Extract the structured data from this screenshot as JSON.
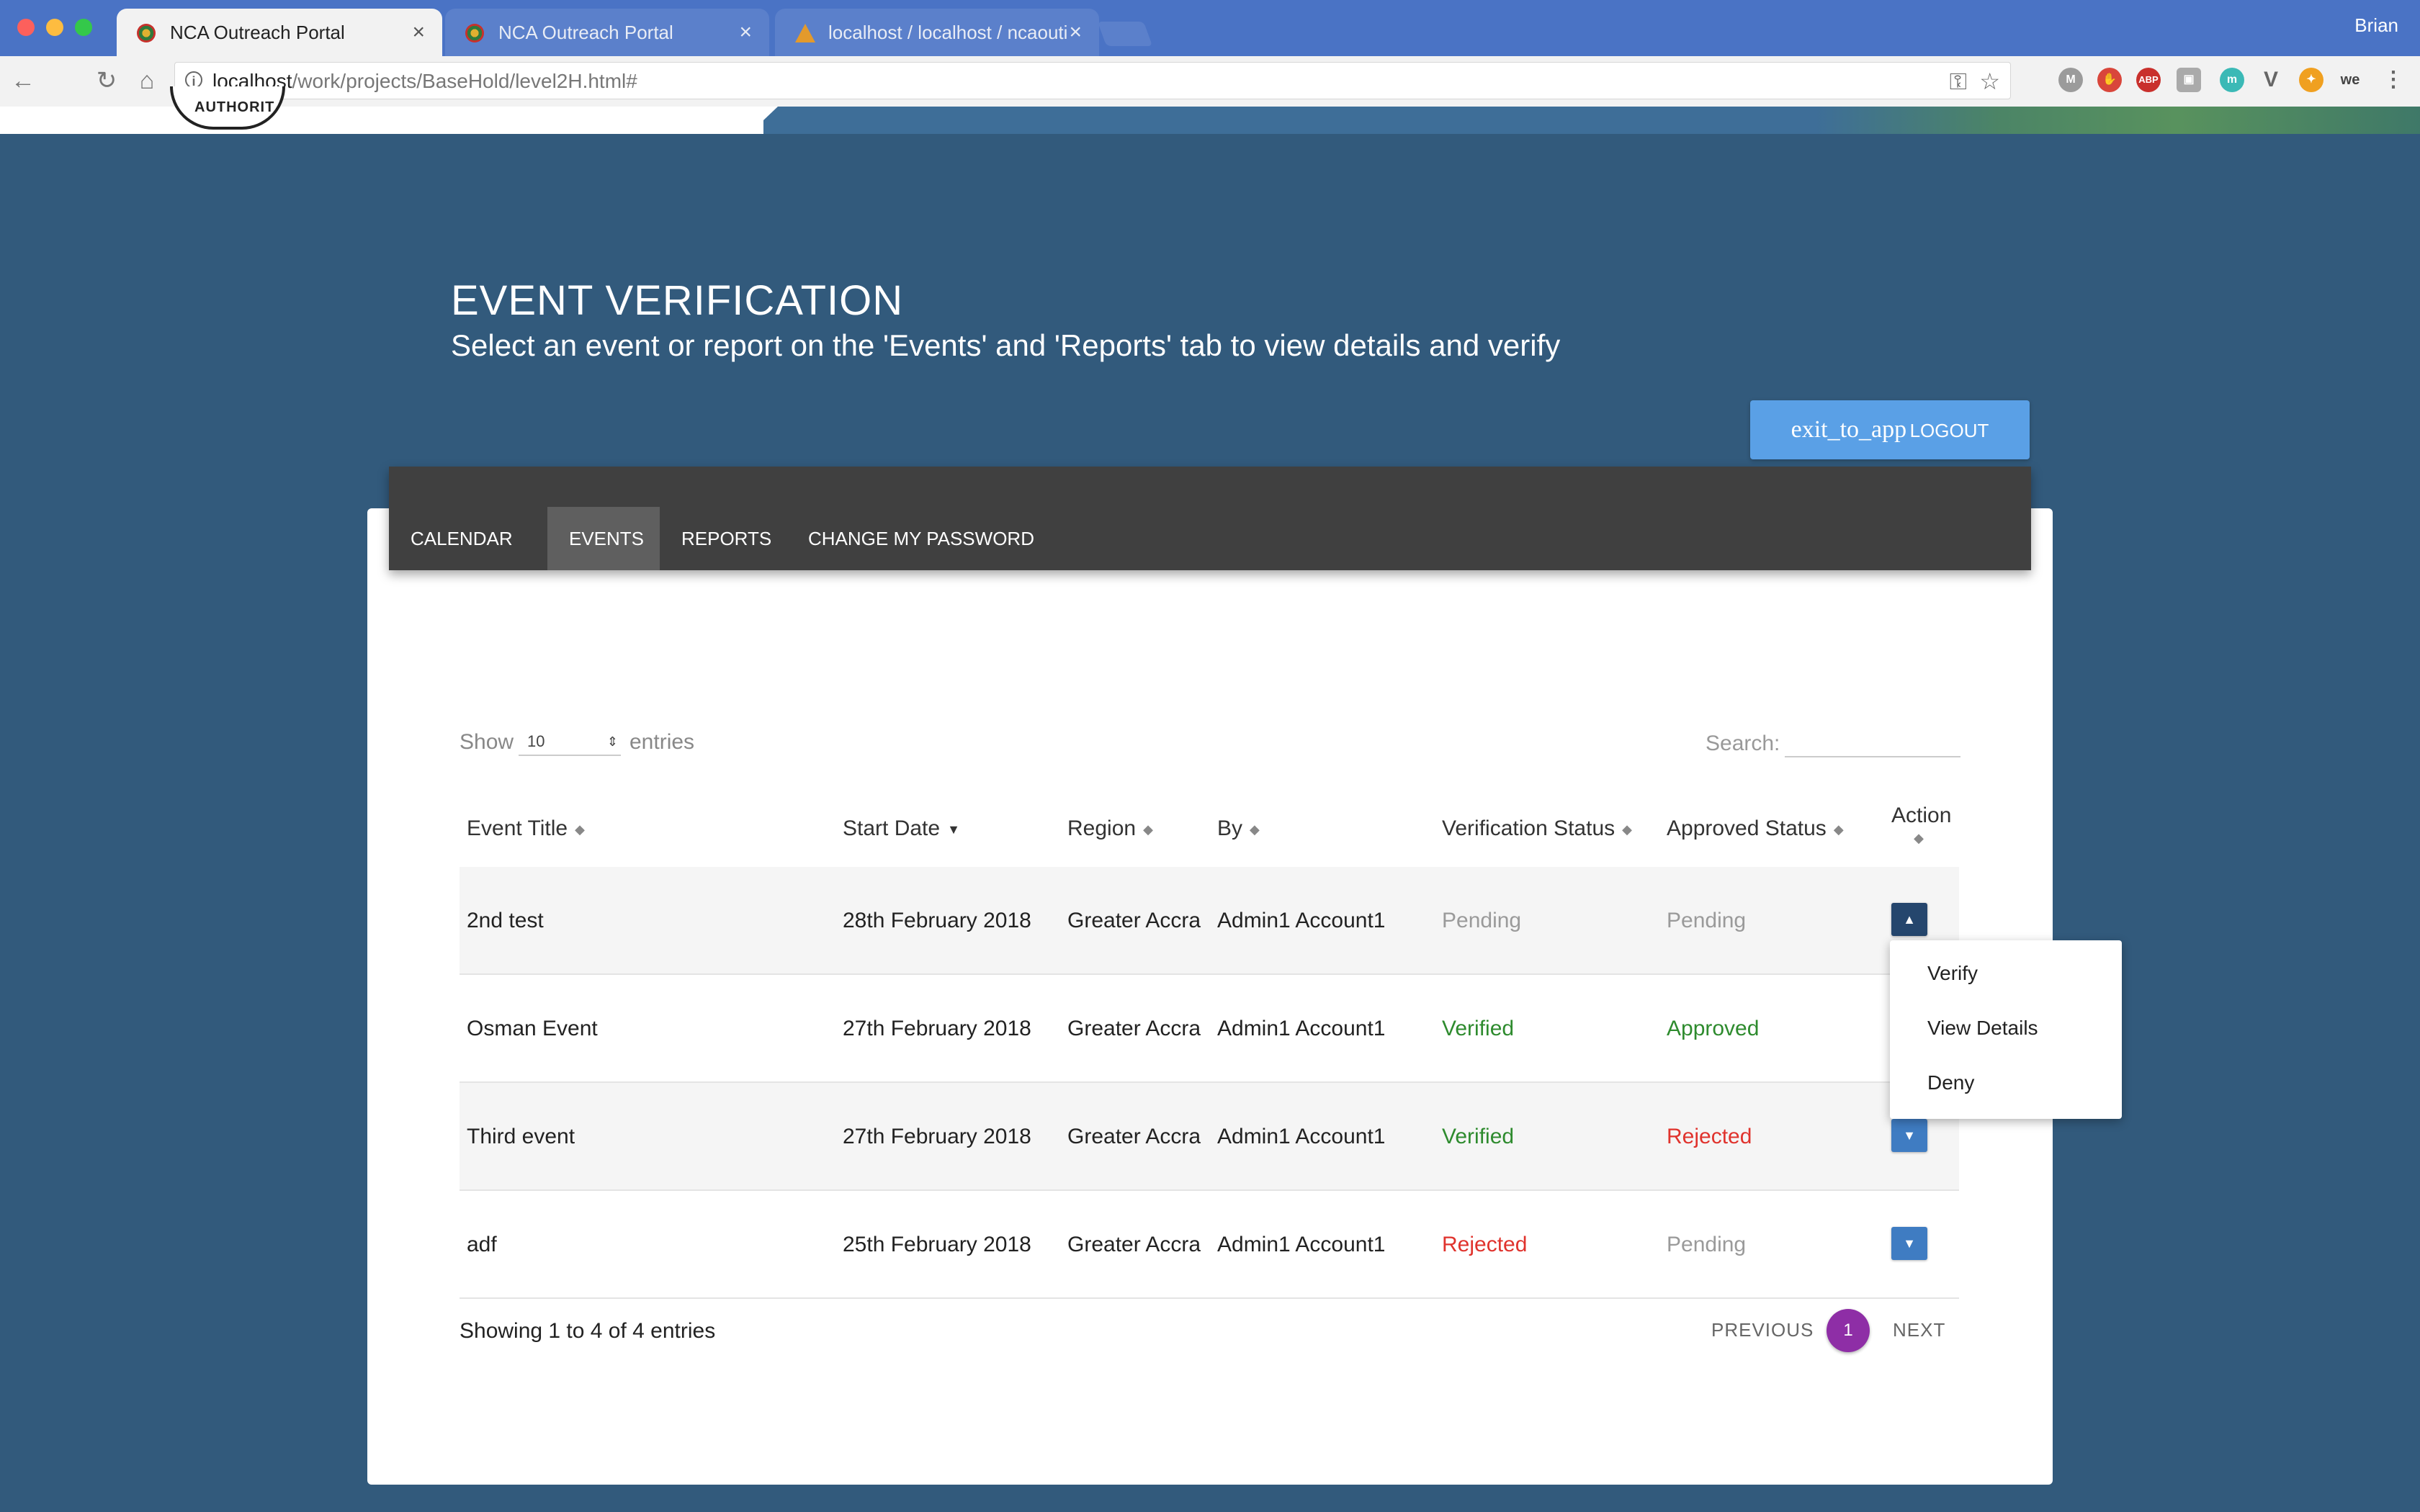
{
  "browser": {
    "tabs": [
      {
        "title": "NCA Outreach Portal",
        "active": true
      },
      {
        "title": "NCA Outreach Portal",
        "active": false
      },
      {
        "title": "localhost / localhost / ncaouti",
        "active": false
      }
    ],
    "user": "Brian",
    "url_host": "localhost",
    "url_path": "/work/projects/BaseHold/level2H.html#",
    "extensions": [
      "M",
      "",
      "ABP",
      "",
      "m",
      "V",
      "",
      "we"
    ]
  },
  "header": {
    "logo_text": "AUTHORIT"
  },
  "page": {
    "title": "EVENT VERIFICATION",
    "subtitle": "Select an event or report on the 'Events' and 'Reports' tab to view details and verify"
  },
  "logout": {
    "icon_text": "exit_to_app",
    "label": "LOGOUT"
  },
  "nav": {
    "items": [
      "CALENDAR",
      "EVENTS",
      "REPORTS",
      "CHANGE MY PASSWORD"
    ],
    "active": "EVENTS"
  },
  "table_controls": {
    "show_label": "Show",
    "length_value": "10",
    "entries_label": "entries",
    "search_label": "Search:",
    "search_value": ""
  },
  "table": {
    "columns": [
      "Event Title",
      "Start Date",
      "Region",
      "By",
      "Verification Status",
      "Approved Status",
      "Action"
    ],
    "rows": [
      {
        "title": "2nd test",
        "date": "28th February 2018",
        "region": "Greater Accra",
        "by": "Admin1 Account1",
        "verification": "Pending",
        "approved": "Pending"
      },
      {
        "title": "Osman Event",
        "date": "27th February 2018",
        "region": "Greater Accra",
        "by": "Admin1 Account1",
        "verification": "Verified",
        "approved": "Approved"
      },
      {
        "title": "Third event",
        "date": "27th February 2018",
        "region": "Greater Accra",
        "by": "Admin1 Account1",
        "verification": "Verified",
        "approved": "Rejected"
      },
      {
        "title": "adf",
        "date": "25th February 2018",
        "region": "Greater Accra",
        "by": "Admin1 Account1",
        "verification": "Rejected",
        "approved": "Pending"
      }
    ]
  },
  "action_menu": {
    "items": [
      "Verify",
      "View Details",
      "Deny"
    ]
  },
  "footer": {
    "info": "Showing 1 to 4 of 4 entries",
    "previous": "PREVIOUS",
    "current_page": "1",
    "next": "NEXT"
  },
  "colors": {
    "page_bg": "#325a7c",
    "logout_btn": "#5aa0e6",
    "navbar": "#404040",
    "action_btn": "#3f7cc2",
    "verified": "#2e8b2e",
    "rejected": "#e0332d",
    "pending": "#9a9a9a",
    "page_badge": "#8e2ea6"
  }
}
